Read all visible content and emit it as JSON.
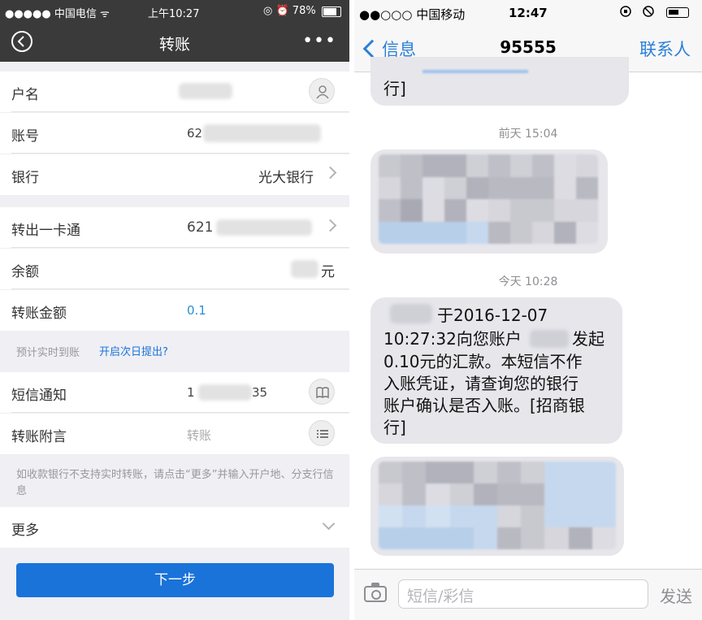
{
  "left": {
    "status": {
      "carrier": "●●●●● 中国电信 ᯤ",
      "time": "上午10:27",
      "battery": "◎ ⏰ 78%"
    },
    "nav": {
      "title": "转账",
      "more": "•••"
    },
    "rows": {
      "name_label": "户名",
      "account_label": "账号",
      "account_value": "62",
      "bank_label": "银行",
      "bank_value": "光大银行",
      "card_label": "转出一卡通",
      "card_value": "621",
      "balance_label": "余额",
      "balance_unit": "元",
      "amount_label": "转账金额",
      "amount_value": "0.1",
      "sms_label": "短信通知",
      "sms_value_start": "1",
      "sms_value_end": "35",
      "remark_label": "转账附言",
      "remark_placeholder": "转账",
      "more_label": "更多"
    },
    "notes": {
      "arrival": "预计实时到账",
      "next_day_link": "开启次日提出?",
      "tip": "如收款银行不支持实时转账，请点击“更多”并输入开户地、分支行信息"
    },
    "next_button": "下一步",
    "accent": "#1a73d9"
  },
  "right": {
    "status": {
      "carrier": "●●○○○ 中国移动",
      "time": "12:47"
    },
    "nav": {
      "back": "信息",
      "title": "95555",
      "contacts": "联系人"
    },
    "first_bubble_tail": "行]",
    "time_1": "前天 15:04",
    "time_2": "今天 10:28",
    "message_lines": [
      "于2016-12-07",
      "10:27:32向您账户",
      "发起",
      "0.10元的汇款。本短信不作",
      "入账凭证，请查询您的银行",
      "账户确认是否入账。[招商银",
      "行]"
    ],
    "input_placeholder": "短信/彩信",
    "send": "发送",
    "accent": "#2c80d8"
  }
}
